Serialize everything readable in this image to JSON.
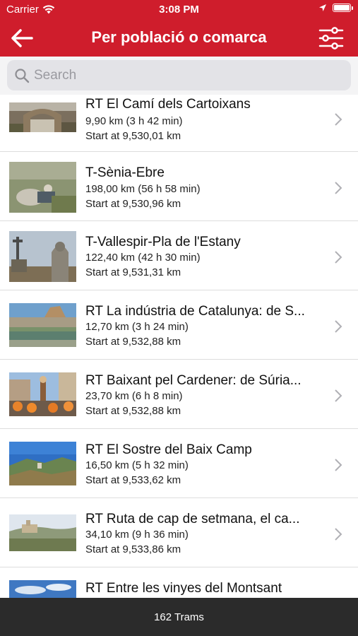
{
  "status": {
    "carrier": "Carrier",
    "time": "3:08 PM"
  },
  "nav": {
    "title": "Per població o comarca"
  },
  "search": {
    "placeholder": "Search"
  },
  "routes": [
    {
      "title": "RT El Camí dels Cartoixans",
      "distance": "9,90 km  (3 h 42 min)",
      "start": "Start at 9,530,01 km",
      "image": "stone-arch"
    },
    {
      "title": "T-Sènia-Ebre",
      "distance": "198,00 km  (56 h 58 min)",
      "start": "Start at 9,530,96 km",
      "image": "hiker-meadow"
    },
    {
      "title": "T-Vallespir-Pla de l'Estany",
      "distance": "122,40 km  (42 h 30 min)",
      "start": "Start at 9,531,31 km",
      "image": "stone-cross-statue"
    },
    {
      "title": "RT La indústria de Catalunya: de S...",
      "distance": "12,70 km  (3 h 24 min)",
      "start": "Start at 9,532,88 km",
      "image": "river-town"
    },
    {
      "title": "RT Baixant pel Cardener: de Súria...",
      "distance": "23,70 km  (6 h 8 min)",
      "start": "Start at 9,532,88 km",
      "image": "festival-crowd"
    },
    {
      "title": "RT El Sostre del Baix Camp",
      "distance": "16,50 km  (5 h 32 min)",
      "start": "Start at 9,533,62 km",
      "image": "mountain-landscape"
    },
    {
      "title": "RT Ruta de cap de setmana, el ca...",
      "distance": "34,10 km  (9 h 36 min)",
      "start": "Start at 9,533,86 km",
      "image": "hill-village"
    },
    {
      "title": "RT Entre les vinyes del Montsant",
      "distance": "",
      "start": "",
      "image": "sky-vineyard"
    }
  ],
  "footer": {
    "count": "162 Trams"
  },
  "colors": {
    "accent": "#cf1d2c",
    "footer": "#2b2b2b"
  }
}
